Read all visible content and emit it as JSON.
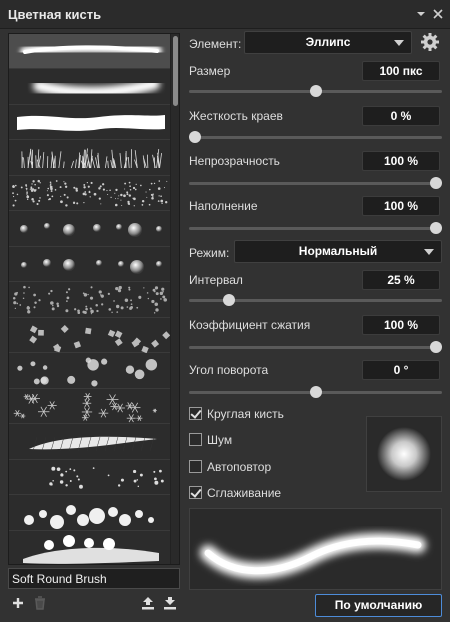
{
  "window": {
    "title": "Цветная кисть"
  },
  "brush_list": {
    "selected_index": 0,
    "items": [
      {
        "kind": "soft-stroke"
      },
      {
        "kind": "soft-wave"
      },
      {
        "kind": "hard-wave"
      },
      {
        "kind": "grass"
      },
      {
        "kind": "speckle"
      },
      {
        "kind": "spheres"
      },
      {
        "kind": "spheres-small"
      },
      {
        "kind": "particles"
      },
      {
        "kind": "leaves"
      },
      {
        "kind": "flowers"
      },
      {
        "kind": "snowflakes"
      },
      {
        "kind": "mesh-stroke"
      },
      {
        "kind": "stars"
      },
      {
        "kind": "bokeh"
      },
      {
        "kind": "bokeh-stroke"
      }
    ],
    "current_name": "Soft Round Brush"
  },
  "element": {
    "label": "Элемент:",
    "value": "Эллипс"
  },
  "size": {
    "label": "Размер",
    "value": "100 пкс",
    "slider": 0.5
  },
  "hardness": {
    "label": "Жесткость краев",
    "value": "0 %",
    "slider": 0.0
  },
  "opacity": {
    "label": "Непрозрачность",
    "value": "100 %",
    "slider": 1.0
  },
  "fill": {
    "label": "Наполнение",
    "value": "100 %",
    "slider": 1.0
  },
  "mode": {
    "label": "Режим:",
    "value": "Нормальный"
  },
  "spacing": {
    "label": "Интервал",
    "value": "25 %",
    "slider": 0.14
  },
  "compression": {
    "label": "Коэффициент сжатия",
    "value": "100 %",
    "slider": 1.0
  },
  "rotation": {
    "label": "Угол поворота",
    "value": "0 °",
    "slider": 0.5
  },
  "options": [
    {
      "label": "Круглая кисть",
      "checked": true
    },
    {
      "label": "Шум",
      "checked": false
    },
    {
      "label": "Автоповтор",
      "checked": false
    },
    {
      "label": "Сглаживание",
      "checked": true
    }
  ],
  "default_button": "По умолчанию",
  "icons": {
    "add": "plus-icon",
    "delete": "trash-icon",
    "import": "upload-icon",
    "export": "download-icon",
    "settings": "gear-icon",
    "menu": "panel-menu-icon",
    "close": "close-icon"
  },
  "colors": {
    "panel": "#323232",
    "field": "#1e1e1e",
    "accent": "#4d8cd9"
  }
}
